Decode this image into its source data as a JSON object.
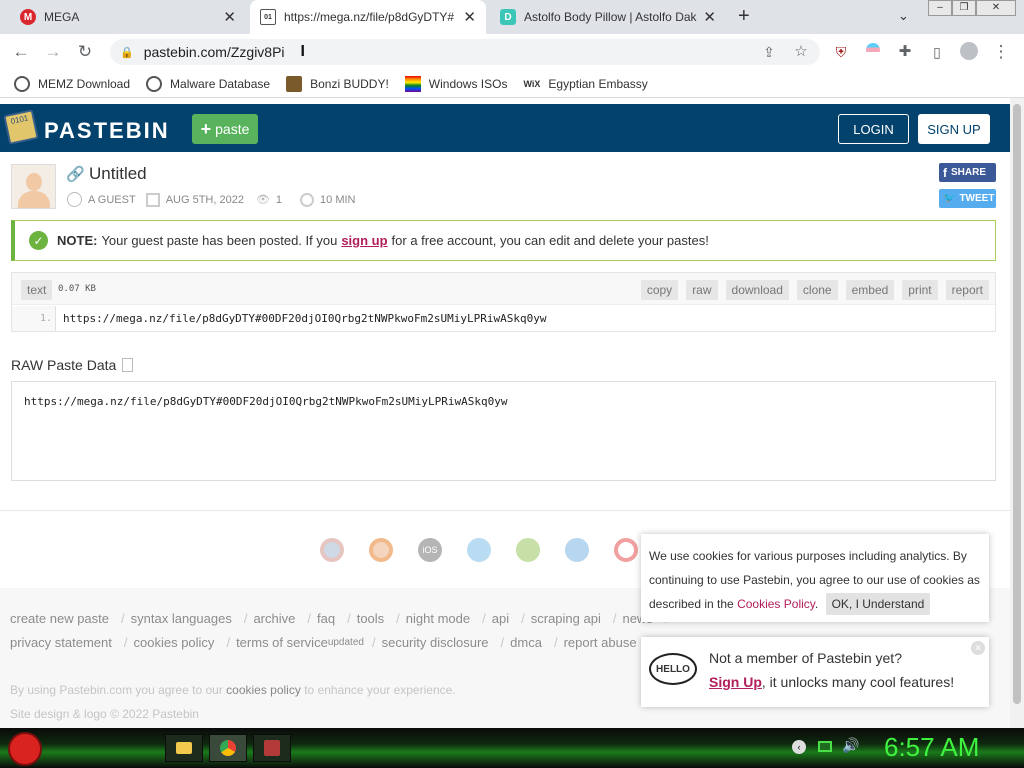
{
  "browser": {
    "tabs": [
      {
        "title": "MEGA",
        "favicon": "mega-icon"
      },
      {
        "title": "https://mega.nz/file/p8dGyDTY#",
        "favicon": "pastebin-icon"
      },
      {
        "title": "Astolfo Body Pillow | Astolfo Dak",
        "favicon": "dakimakura-icon"
      }
    ],
    "address": "pastebin.com/Zzgiv8Pi",
    "bookmarks": [
      "MEMZ Download",
      "Malware Database",
      "Bonzi BUDDY!",
      "Windows ISOs",
      "Egyptian Embassy"
    ]
  },
  "pastebin": {
    "logo": "PASTEBIN",
    "new_paste": "paste",
    "login": "LOGIN",
    "signup": "SIGN UP",
    "paste_title": "Untitled",
    "author": "A GUEST",
    "date": "AUG 5TH, 2022",
    "views": "1",
    "expire": "10 MIN",
    "share": "SHARE",
    "tweet": "TWEET",
    "notice": {
      "label": "NOTE:",
      "before": "Your guest paste has been posted. If you",
      "link": "sign up",
      "after": "for a free account, you can edit and delete your pastes!"
    },
    "syntax": "text",
    "size": "0.07 KB",
    "actions": [
      "copy",
      "raw",
      "download",
      "clone",
      "embed",
      "print",
      "report"
    ],
    "line_number": "1.",
    "code": "https://mega.nz/file/p8dGyDTY#00DF20djOI0Qrbg2tNWPkwoFm2sUMiyLPRiwASkq0yw",
    "raw_title": "RAW Paste Data",
    "raw_text": "https://mega.nz/file/p8dGyDTY#00DF20djOI0Qrbg2tNWPkwoFm2sUMiyLPRiwASkq0yw",
    "footer_row1": [
      "create new paste",
      "syntax languages",
      "archive",
      "faq",
      "tools",
      "night mode",
      "api",
      "scraping api",
      "news"
    ],
    "footer_row2": [
      "privacy statement",
      "cookies policy",
      "terms of service",
      "security disclosure",
      "dmca",
      "report abuse"
    ],
    "tos_sup": "updated",
    "legal_before": "By using Pastebin.com you agree to our",
    "legal_link": "cookies policy",
    "legal_after": "to enhance your experience.",
    "copyright": "Site design & logo © 2022 Pastebin",
    "cookie": {
      "text": "We use cookies for various purposes including analytics. By continuing to use Pastebin, you agree to our use of cookies as described in the",
      "link": "Cookies Policy",
      "button": "OK, I Understand"
    },
    "member": {
      "hello": "HELLO",
      "line1": "Not a member of Pastebin yet?",
      "link": "Sign Up",
      "line2": ", it unlocks many cool features!"
    }
  },
  "taskbar": {
    "time": "6:57 AM"
  }
}
